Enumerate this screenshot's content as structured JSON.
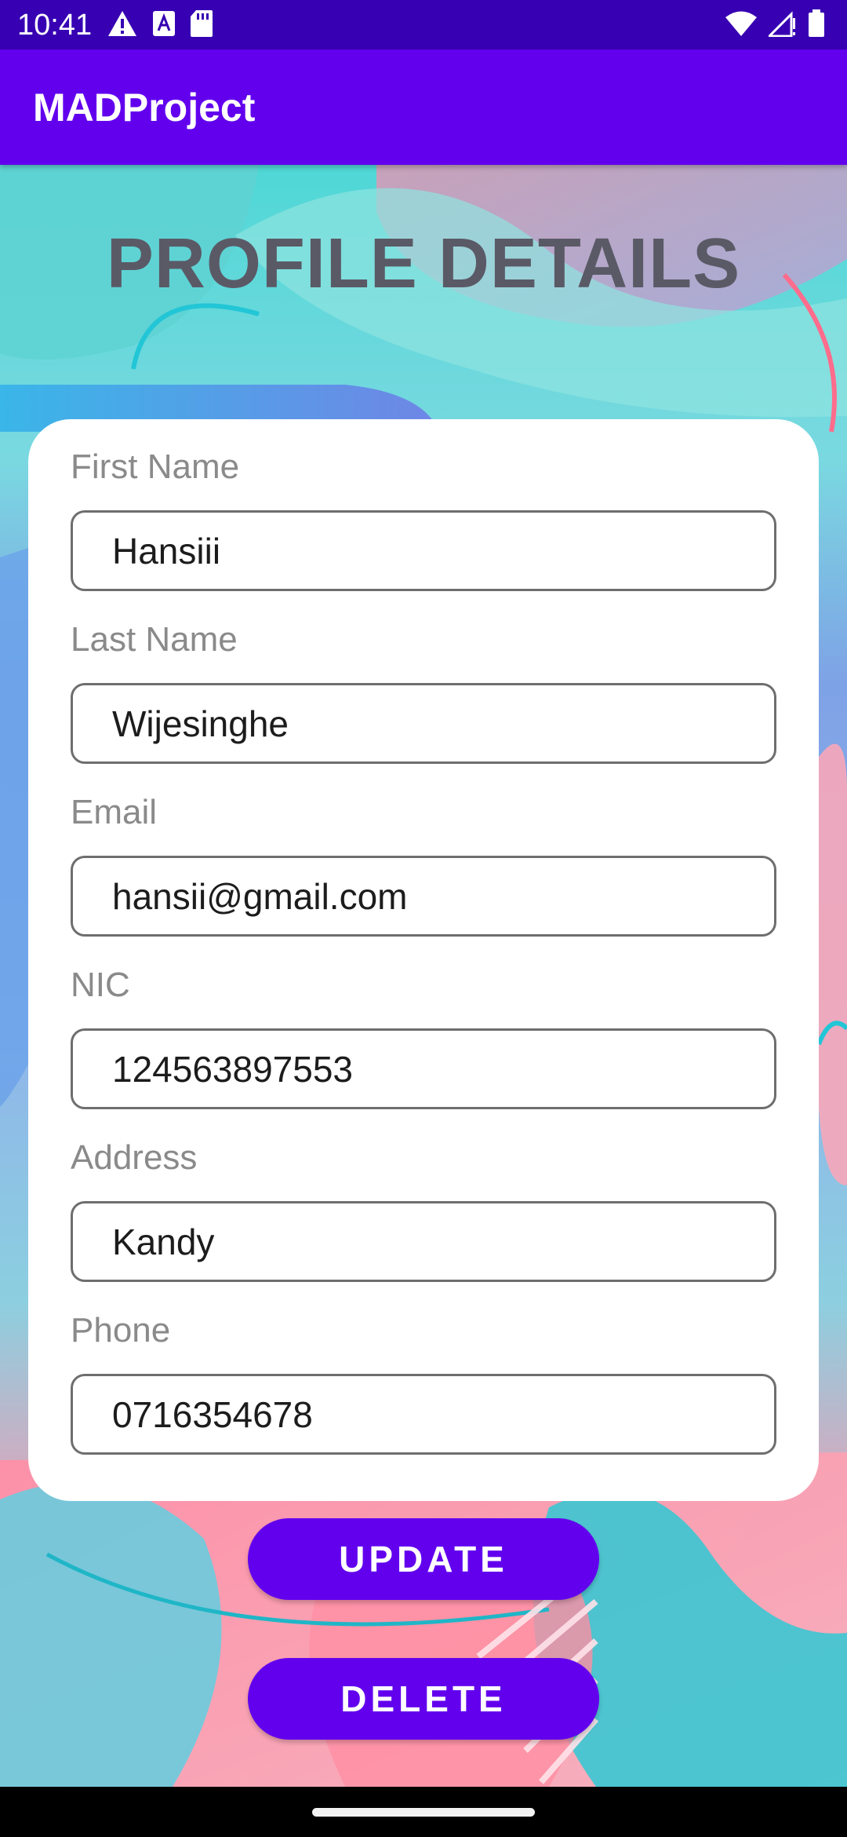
{
  "status_bar": {
    "time": "10:41",
    "left_icons": [
      "warning-icon",
      "a-text-icon",
      "sd-card-icon"
    ],
    "right_icons": [
      "wifi-icon",
      "signal-icon",
      "battery-icon"
    ]
  },
  "app_bar": {
    "title": "MADProject"
  },
  "page": {
    "title": "PROFILE DETAILS"
  },
  "form": {
    "fields": [
      {
        "label": "First Name",
        "value": "Hansiii"
      },
      {
        "label": "Last Name",
        "value": "Wijesinghe"
      },
      {
        "label": "Email",
        "value": "hansii@gmail.com"
      },
      {
        "label": "NIC",
        "value": "124563897553"
      },
      {
        "label": "Address",
        "value": "Kandy"
      },
      {
        "label": "Phone",
        "value": "0716354678"
      }
    ]
  },
  "actions": {
    "update_label": "UPDATE",
    "delete_label": "DELETE"
  },
  "colors": {
    "status_bar": "#3700B3",
    "app_bar": "#6200EE",
    "button": "#6200EE",
    "title_text": "#5a5a66"
  }
}
